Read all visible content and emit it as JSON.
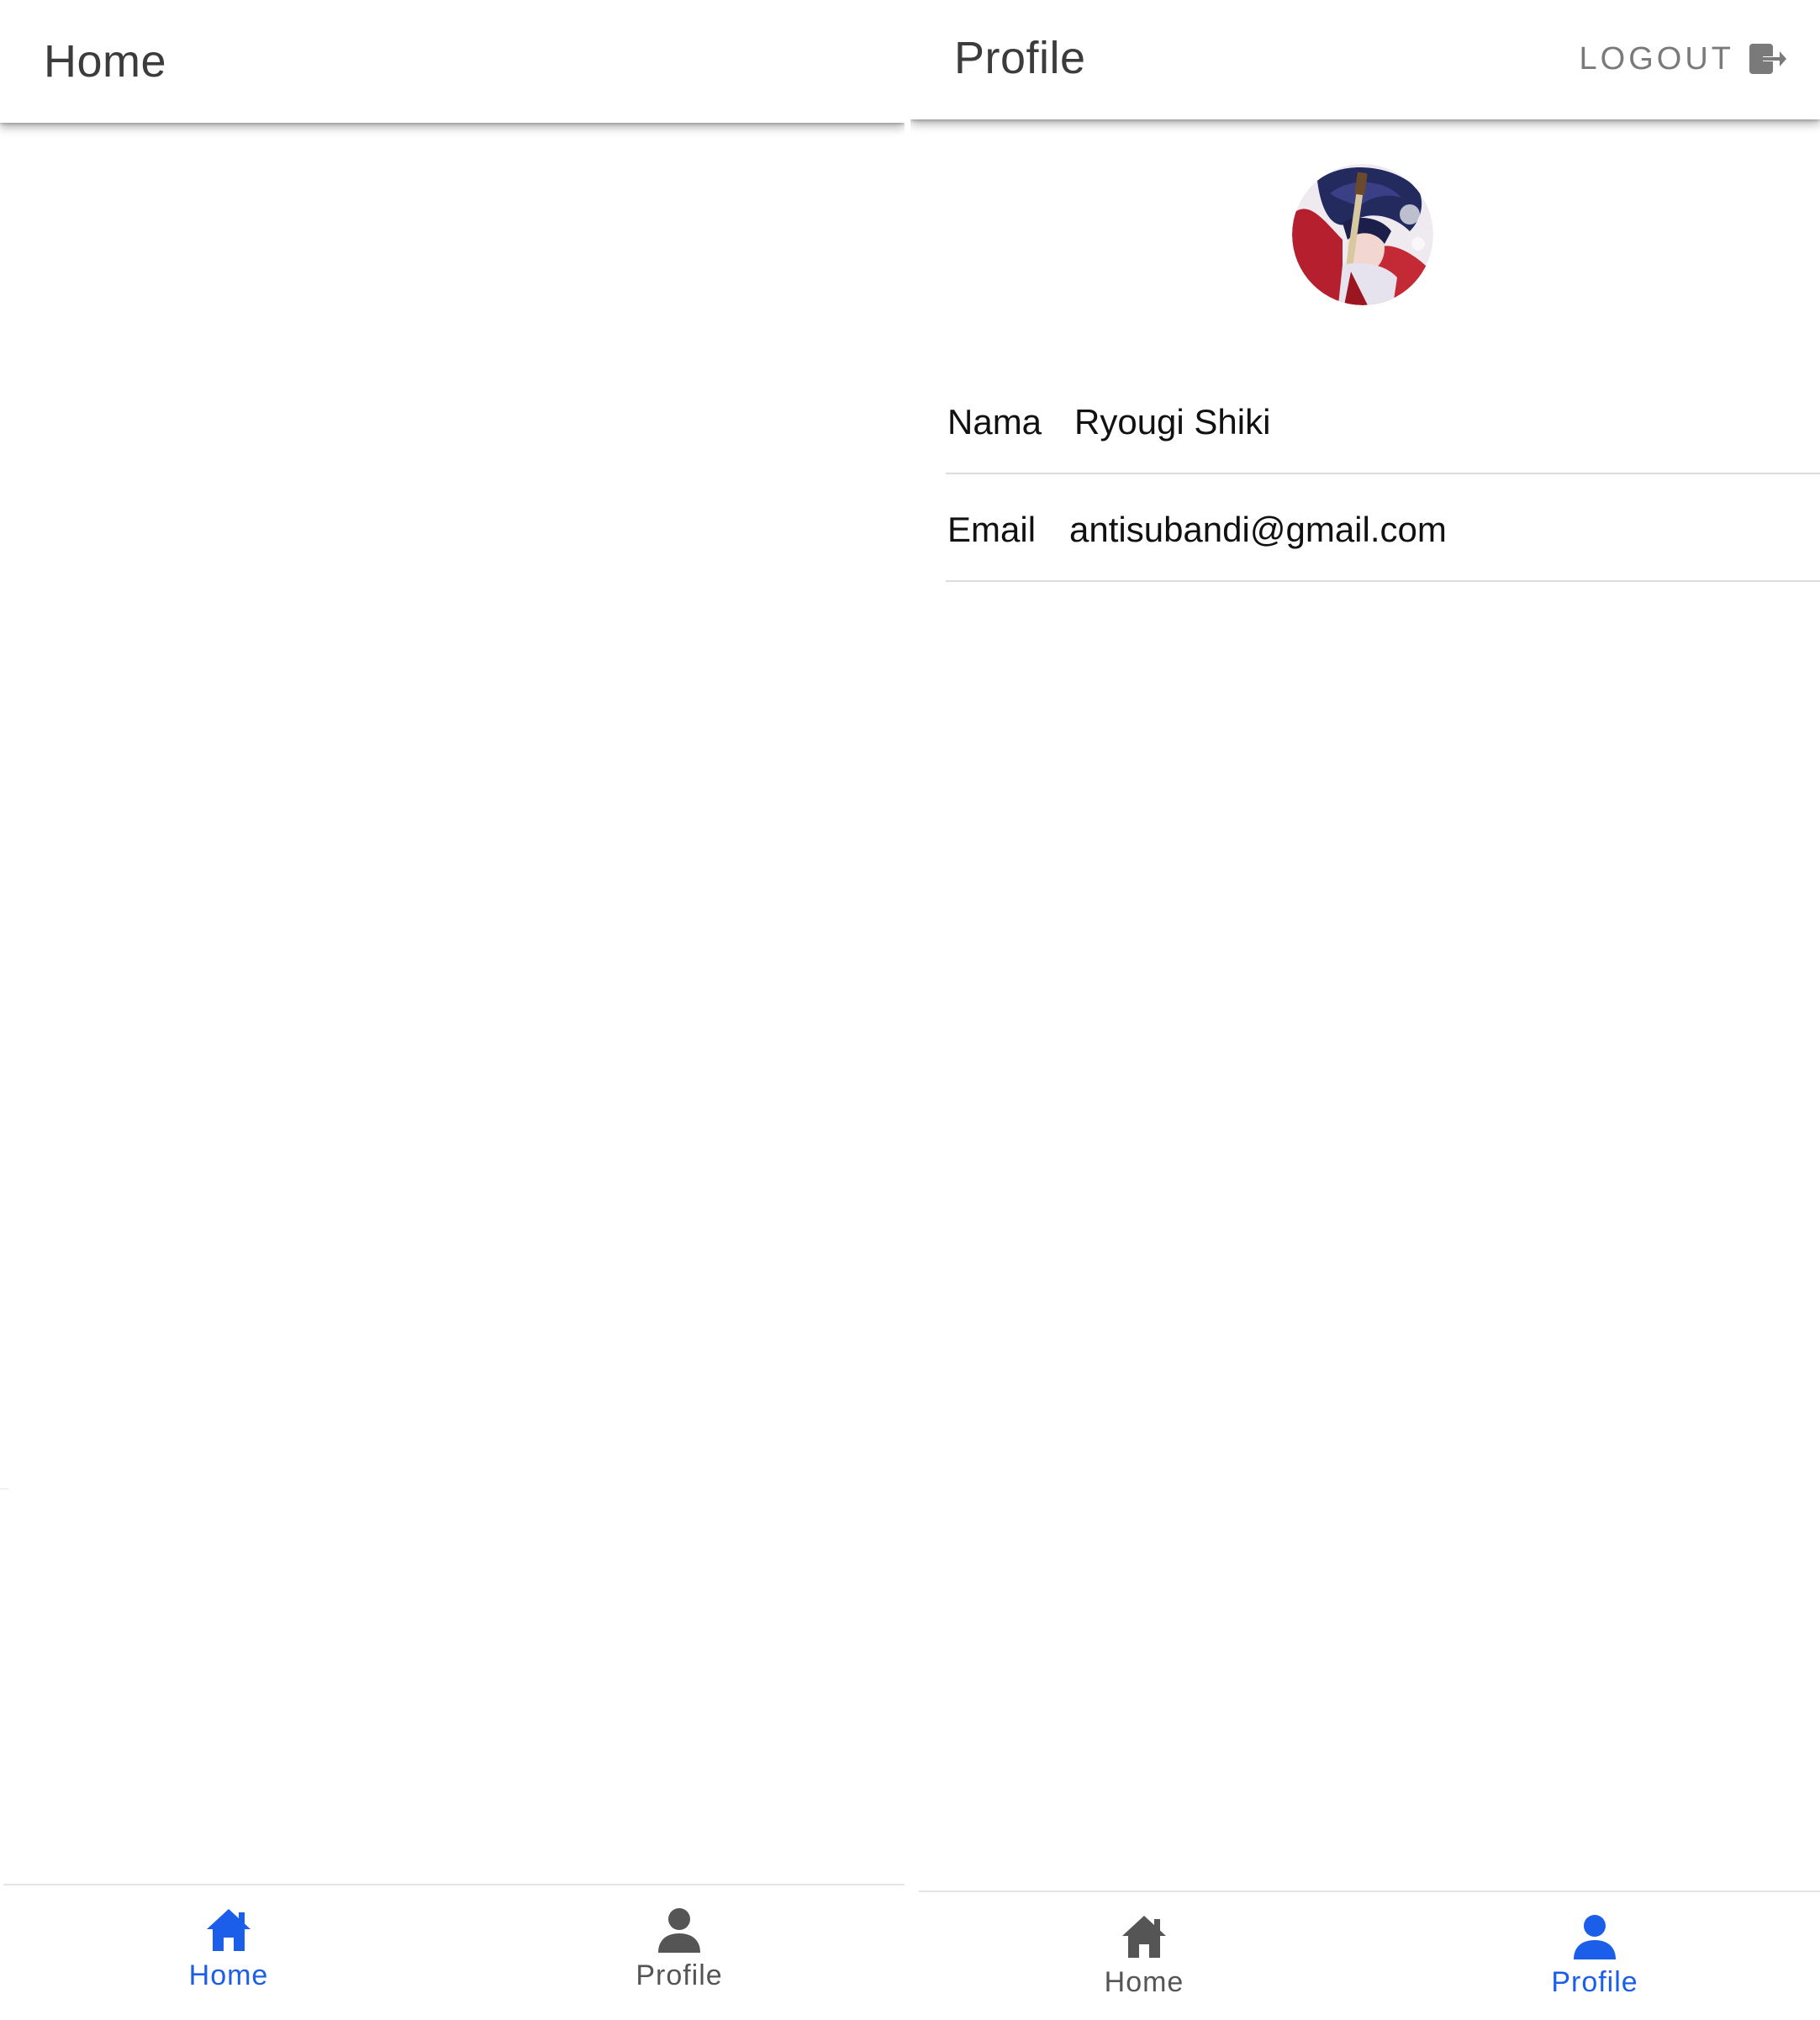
{
  "colors": {
    "accent": "#1a5eea",
    "inactive": "#555555",
    "title": "#3c3c3c",
    "logout": "#7a7a7a"
  },
  "home_screen": {
    "title": "Home",
    "tabs": [
      {
        "label": "Home",
        "icon": "home-icon",
        "active": true
      },
      {
        "label": "Profile",
        "icon": "person-icon",
        "active": false
      }
    ]
  },
  "profile_screen": {
    "title": "Profile",
    "logout_label": "LOGOUT",
    "logout_icon": "logout-icon",
    "fields": [
      {
        "label": "Nama",
        "value": "Ryougi Shiki"
      },
      {
        "label": "Email",
        "value": "antisubandi@gmail.com"
      }
    ],
    "tabs": [
      {
        "label": "Home",
        "icon": "home-icon",
        "active": false
      },
      {
        "label": "Profile",
        "icon": "person-icon",
        "active": true
      }
    ]
  }
}
